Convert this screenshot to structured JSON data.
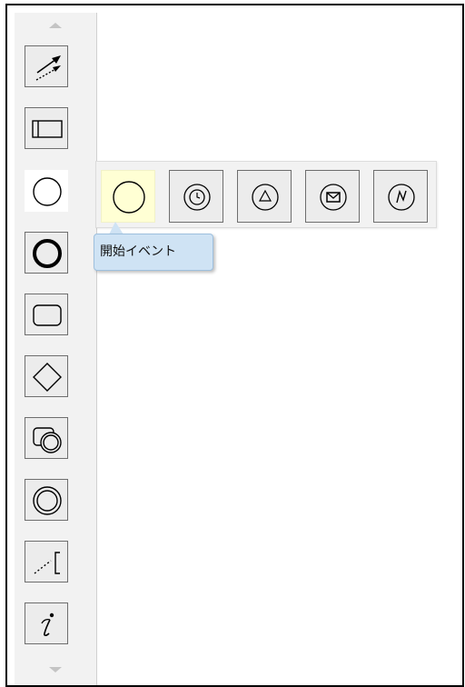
{
  "palette": {
    "scroll_up_icon": "triangle-up-icon",
    "scroll_down_icon": "triangle-down-icon",
    "tools": [
      {
        "name": "connector-tool",
        "icon": "connector-arrows-icon"
      },
      {
        "name": "pool-tool",
        "icon": "pool-lane-icon"
      },
      {
        "name": "start-event-tool",
        "icon": "thin-circle-icon",
        "active": true
      },
      {
        "name": "end-event-tool",
        "icon": "thick-circle-icon"
      },
      {
        "name": "task-tool",
        "icon": "rounded-rectangle-icon"
      },
      {
        "name": "gateway-tool",
        "icon": "diamond-icon"
      },
      {
        "name": "subprocess-tool",
        "icon": "rect-with-circle-icon"
      },
      {
        "name": "intermediate-event-tool",
        "icon": "double-circle-icon"
      },
      {
        "name": "annotation-tool",
        "icon": "dotted-bracket-icon"
      },
      {
        "name": "data-object-tool",
        "icon": "italic-i-icon"
      }
    ]
  },
  "flyout": {
    "items": [
      {
        "name": "start-event",
        "icon": "circle-icon",
        "highlighted": true
      },
      {
        "name": "timer-start-event",
        "icon": "clock-circle-icon"
      },
      {
        "name": "signal-start-event",
        "icon": "triangle-circle-icon"
      },
      {
        "name": "message-start-event",
        "icon": "envelope-circle-icon"
      },
      {
        "name": "escalation-start-event",
        "icon": "zigzag-circle-icon"
      }
    ]
  },
  "tooltip": {
    "text": "開始イベント"
  },
  "colors": {
    "palette_bg": "#f2f2f2",
    "button_border": "#6e6e6e",
    "highlight": "#ffffd4",
    "tooltip_bg": "#cfe3f4"
  }
}
